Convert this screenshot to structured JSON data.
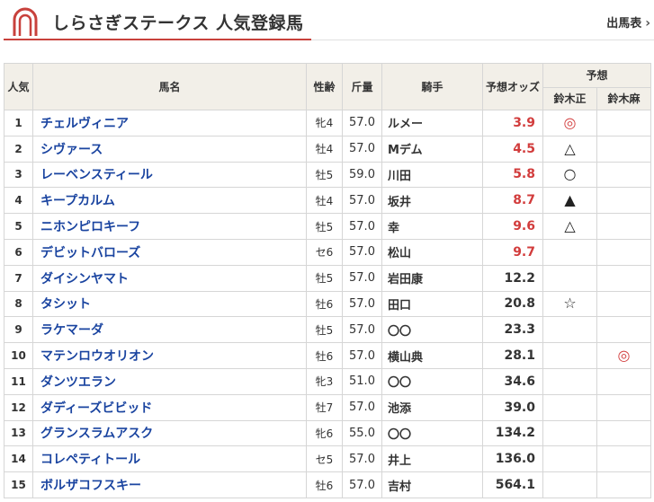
{
  "header": {
    "title": "しらさぎステークス 人気登録馬",
    "entries_link": "出馬表",
    "chevron": "›"
  },
  "colors": {
    "accent": "#c8413c",
    "link": "#1a44a0",
    "odds_hot": "#d23c3c",
    "header_bg": "#f2efe8"
  },
  "table": {
    "headers": {
      "rank": "人気",
      "name": "馬名",
      "sexage": "性齢",
      "weight": "斤量",
      "jockey": "騎手",
      "odds": "予想オッズ",
      "forecast": "予想",
      "forecaster1": "鈴木正",
      "forecaster2": "鈴木麻"
    },
    "rows": [
      {
        "rank": "1",
        "name": "チェルヴィニア",
        "sexage": "牝4",
        "weight": "57.0",
        "jockey": "ルメー",
        "odds": "3.9",
        "hot": true,
        "mark1": "◎",
        "mark1_red": true,
        "mark2": "",
        "mark2_red": false
      },
      {
        "rank": "2",
        "name": "シヴァース",
        "sexage": "牡4",
        "weight": "57.0",
        "jockey": "Mデム",
        "odds": "4.5",
        "hot": true,
        "mark1": "△",
        "mark1_red": false,
        "mark2": "",
        "mark2_red": false
      },
      {
        "rank": "3",
        "name": "レーベンスティール",
        "sexage": "牡5",
        "weight": "59.0",
        "jockey": "川田",
        "odds": "5.8",
        "hot": true,
        "mark1": "○",
        "mark1_red": false,
        "mark2": "",
        "mark2_red": false
      },
      {
        "rank": "4",
        "name": "キープカルム",
        "sexage": "牡4",
        "weight": "57.0",
        "jockey": "坂井",
        "odds": "8.7",
        "hot": true,
        "mark1": "▲",
        "mark1_red": false,
        "mark2": "",
        "mark2_red": false
      },
      {
        "rank": "5",
        "name": "ニホンピロキーフ",
        "sexage": "牡5",
        "weight": "57.0",
        "jockey": "幸",
        "odds": "9.6",
        "hot": true,
        "mark1": "△",
        "mark1_red": false,
        "mark2": "",
        "mark2_red": false
      },
      {
        "rank": "6",
        "name": "デビットバローズ",
        "sexage": "セ6",
        "weight": "57.0",
        "jockey": "松山",
        "odds": "9.7",
        "hot": true,
        "mark1": "",
        "mark1_red": false,
        "mark2": "",
        "mark2_red": false
      },
      {
        "rank": "7",
        "name": "ダイシンヤマト",
        "sexage": "牡5",
        "weight": "57.0",
        "jockey": "岩田康",
        "odds": "12.2",
        "hot": false,
        "mark1": "",
        "mark1_red": false,
        "mark2": "",
        "mark2_red": false
      },
      {
        "rank": "8",
        "name": "タシット",
        "sexage": "牡6",
        "weight": "57.0",
        "jockey": "田口",
        "odds": "20.8",
        "hot": false,
        "mark1": "☆",
        "mark1_red": false,
        "mark2": "",
        "mark2_red": false
      },
      {
        "rank": "9",
        "name": "ラケマーダ",
        "sexage": "牡5",
        "weight": "57.0",
        "jockey": "〇〇",
        "odds": "23.3",
        "hot": false,
        "mark1": "",
        "mark1_red": false,
        "mark2": "",
        "mark2_red": false
      },
      {
        "rank": "10",
        "name": "マテンロウオリオン",
        "sexage": "牡6",
        "weight": "57.0",
        "jockey": "横山典",
        "odds": "28.1",
        "hot": false,
        "mark1": "",
        "mark1_red": false,
        "mark2": "◎",
        "mark2_red": true
      },
      {
        "rank": "11",
        "name": "ダンツエラン",
        "sexage": "牝3",
        "weight": "51.0",
        "jockey": "〇〇",
        "odds": "34.6",
        "hot": false,
        "mark1": "",
        "mark1_red": false,
        "mark2": "",
        "mark2_red": false
      },
      {
        "rank": "12",
        "name": "ダディーズビビッド",
        "sexage": "牡7",
        "weight": "57.0",
        "jockey": "池添",
        "odds": "39.0",
        "hot": false,
        "mark1": "",
        "mark1_red": false,
        "mark2": "",
        "mark2_red": false
      },
      {
        "rank": "13",
        "name": "グランスラムアスク",
        "sexage": "牝6",
        "weight": "55.0",
        "jockey": "〇〇",
        "odds": "134.2",
        "hot": false,
        "mark1": "",
        "mark1_red": false,
        "mark2": "",
        "mark2_red": false
      },
      {
        "rank": "14",
        "name": "コレペティトール",
        "sexage": "セ5",
        "weight": "57.0",
        "jockey": "井上",
        "odds": "136.0",
        "hot": false,
        "mark1": "",
        "mark1_red": false,
        "mark2": "",
        "mark2_red": false
      },
      {
        "rank": "15",
        "name": "ボルザコフスキー",
        "sexage": "牡6",
        "weight": "57.0",
        "jockey": "吉村",
        "odds": "564.1",
        "hot": false,
        "mark1": "",
        "mark1_red": false,
        "mark2": "",
        "mark2_red": false
      }
    ]
  }
}
